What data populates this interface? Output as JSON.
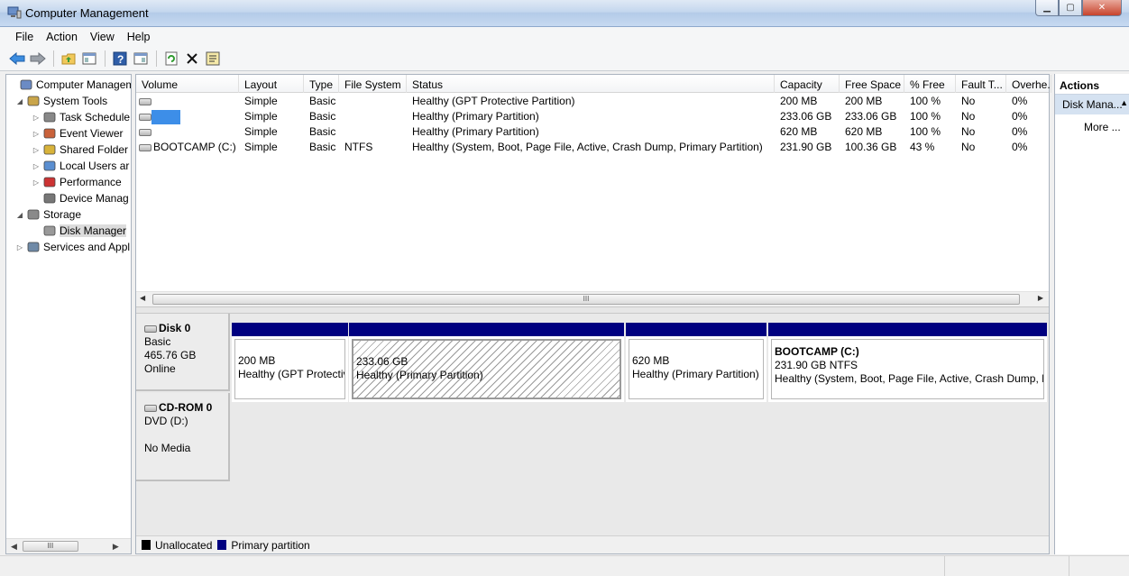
{
  "window": {
    "title": "Computer Management"
  },
  "menu": [
    "File",
    "Action",
    "View",
    "Help"
  ],
  "toolbar_icons": [
    "back-arrow-icon",
    "forward-arrow-icon",
    "up-folder-icon",
    "show-hide-tree-icon",
    "help-icon",
    "properties-icon",
    "refresh-icon",
    "delete-icon",
    "settings-icon"
  ],
  "tree": [
    {
      "label": "Computer Managem",
      "level": 0,
      "expander": "",
      "icon": "computer-icon"
    },
    {
      "label": "System Tools",
      "level": 1,
      "expander": "◢",
      "icon": "tools-icon"
    },
    {
      "label": "Task Schedule",
      "level": 2,
      "expander": "▷",
      "icon": "clock-icon"
    },
    {
      "label": "Event Viewer",
      "level": 2,
      "expander": "▷",
      "icon": "event-viewer-icon"
    },
    {
      "label": "Shared Folder",
      "level": 2,
      "expander": "▷",
      "icon": "shared-folder-icon"
    },
    {
      "label": "Local Users ar",
      "level": 2,
      "expander": "▷",
      "icon": "users-icon"
    },
    {
      "label": "Performance",
      "level": 2,
      "expander": "▷",
      "icon": "performance-icon"
    },
    {
      "label": "Device Manag",
      "level": 2,
      "expander": "",
      "icon": "device-manager-icon"
    },
    {
      "label": "Storage",
      "level": 1,
      "expander": "◢",
      "icon": "storage-icon"
    },
    {
      "label": "Disk Manager",
      "level": 2,
      "expander": "",
      "icon": "disk-management-icon",
      "selected": true
    },
    {
      "label": "Services and Appl",
      "level": 1,
      "expander": "▷",
      "icon": "services-icon"
    }
  ],
  "tree_scroll_thumb": "III",
  "volume_table": {
    "columns": [
      "Volume",
      "Layout",
      "Type",
      "File System",
      "Status",
      "Capacity",
      "Free Space",
      "% Free",
      "Fault T...",
      "Overhe..."
    ],
    "rows": [
      {
        "volume": "",
        "layout": "Simple",
        "type": "Basic",
        "fs": "",
        "status": "Healthy (GPT Protective Partition)",
        "capacity": "200 MB",
        "free": "200 MB",
        "pct": "100 %",
        "fault": "No",
        "overhead": "0%"
      },
      {
        "volume": "",
        "redacted": true,
        "layout": "Simple",
        "type": "Basic",
        "fs": "",
        "status": "Healthy (Primary Partition)",
        "capacity": "233.06 GB",
        "free": "233.06 GB",
        "pct": "100 %",
        "fault": "No",
        "overhead": "0%"
      },
      {
        "volume": "",
        "layout": "Simple",
        "type": "Basic",
        "fs": "",
        "status": "Healthy (Primary Partition)",
        "capacity": "620 MB",
        "free": "620 MB",
        "pct": "100 %",
        "fault": "No",
        "overhead": "0%"
      },
      {
        "volume": "BOOTCAMP (C:)",
        "layout": "Simple",
        "type": "Basic",
        "fs": "NTFS",
        "status": "Healthy (System, Boot, Page File, Active, Crash Dump, Primary Partition)",
        "capacity": "231.90 GB",
        "free": "100.36 GB",
        "pct": "43 %",
        "fault": "No",
        "overhead": "0%"
      }
    ]
  },
  "scroll_thumb": "III",
  "disks": [
    {
      "name": "Disk 0",
      "lines": [
        "Basic",
        "465.76 GB",
        "Online"
      ],
      "partitions": [
        {
          "title": "",
          "line1": "200 MB",
          "line2": "Healthy (GPT Protective Partition)"
        },
        {
          "title": "",
          "line1": "233.06 GB",
          "line2": "Healthy (Primary Partition)",
          "hatched": true
        },
        {
          "title": "",
          "line1": "620 MB",
          "line2": "Healthy (Primary Partition)"
        },
        {
          "title": "BOOTCAMP  (C:)",
          "line1": "231.90 GB NTFS",
          "line2": "Healthy (System, Boot, Page File, Active, Crash Dump, Primary Partition)"
        }
      ]
    },
    {
      "name": "CD-ROM 0",
      "lines": [
        "DVD (D:)",
        "",
        "No Media"
      ]
    }
  ],
  "legend": [
    {
      "label": "Unallocated",
      "color": "#000000"
    },
    {
      "label": "Primary partition",
      "color": "#000080"
    }
  ],
  "actions": {
    "header": "Actions",
    "selected": "Disk Mana...",
    "more": "More ..."
  },
  "colors": {
    "partition_bar": "#000080",
    "selection": "#d5e2f1"
  }
}
